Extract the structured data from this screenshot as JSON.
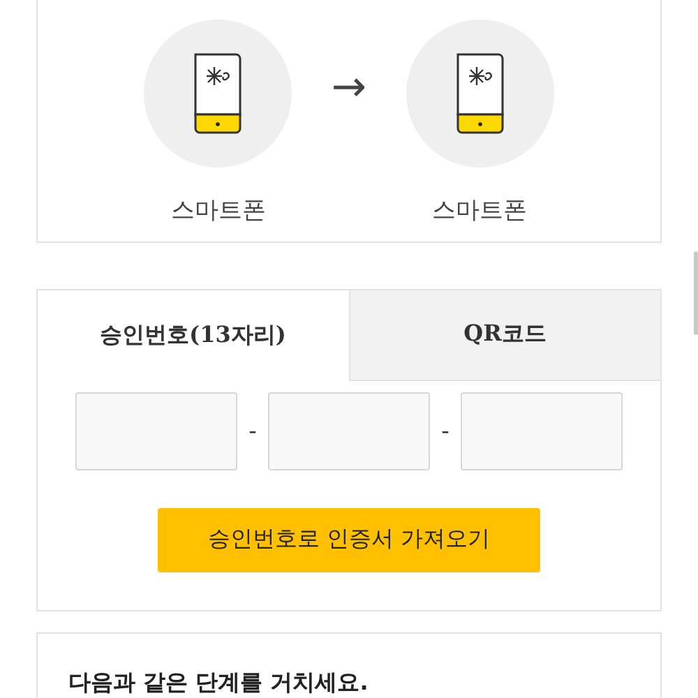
{
  "transfer": {
    "from": {
      "label": "스마트폰"
    },
    "arrow": "→",
    "to": {
      "label": "스마트폰"
    }
  },
  "tabs": [
    {
      "label": "승인번호(13자리)",
      "selected": true
    },
    {
      "label": "QR코드",
      "selected": false
    }
  ],
  "code_fields": [
    {
      "kind": "text"
    },
    {
      "kind": "text"
    },
    {
      "kind": "text"
    }
  ],
  "separator": "-",
  "import_button": "승인번호로 인증서 가져오기",
  "steps": {
    "title": "다음과 같은 단계를 거치세요."
  }
}
